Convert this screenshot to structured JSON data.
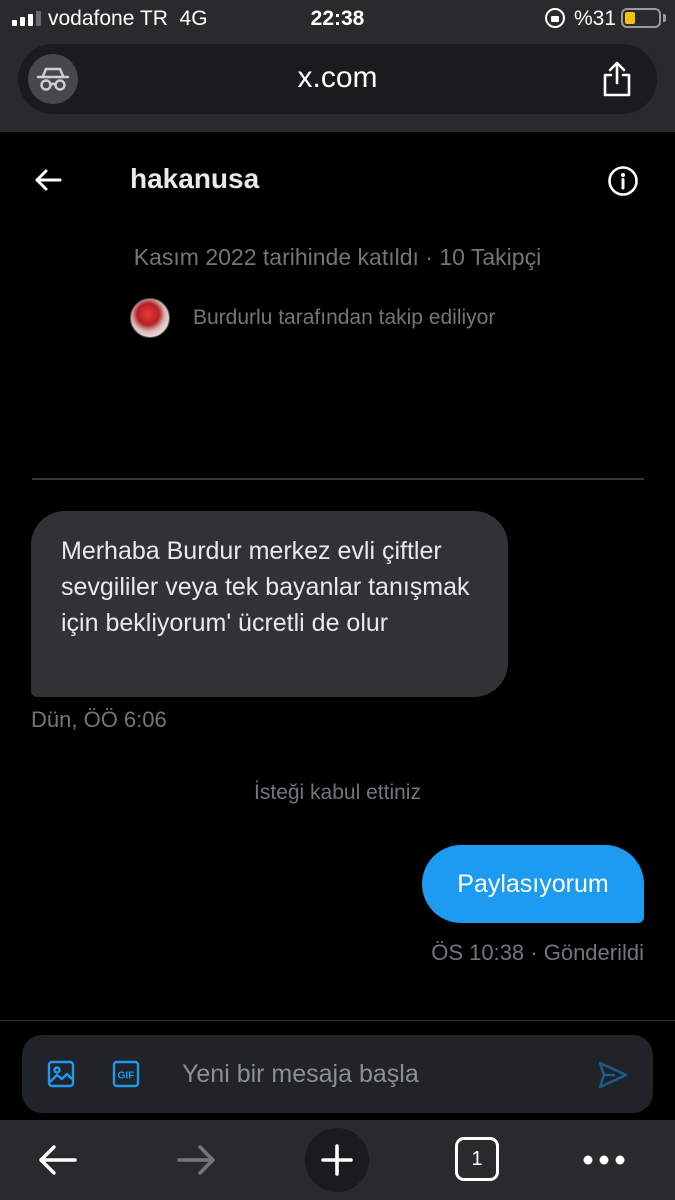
{
  "status_bar": {
    "carrier": "vodafone TR  4G",
    "time": "22:38",
    "battery": "%31",
    "battery_level": 0.31
  },
  "browser": {
    "url": "x.com",
    "icons": {
      "incognito": "incognito-icon",
      "share": "share-icon"
    }
  },
  "chat": {
    "title": "hakanusa",
    "profile_meta": "Kasım 2022 tarihinde katıldı · 10 Takipçi",
    "followed_by": "Burdurlu tarafından takip ediliyor",
    "icons": {
      "back": "arrow-left-icon",
      "info": "info-icon"
    }
  },
  "messages": [
    {
      "direction": "incoming",
      "text": "Merhaba Burdur merkez evli çiftler sevgililer veya tek bayanlar tanışmak için bekliyorum' ücretli de olur",
      "time": "Dün, ÖÖ 6:06"
    },
    {
      "direction": "outgoing",
      "text": "Paylasıyorum",
      "time": "ÖS 10:38 · Gönderildi"
    }
  ],
  "request_note": "İsteği kabul ettiniz",
  "composer": {
    "placeholder": "Yeni bir mesaja başla",
    "accent": "#1d9bf0",
    "icons": {
      "media": "image-icon",
      "gif": "gif-icon",
      "send": "send-icon"
    }
  },
  "toolbar": {
    "tab_count": "1",
    "icons": {
      "back": "arrow-left-icon",
      "forward": "arrow-right-icon",
      "new_tab": "plus-icon",
      "tabs": "tabs-icon",
      "more": "more-icon"
    }
  },
  "colors": {
    "background": "#000000",
    "bubble_incoming": "#2f3336",
    "bubble_outgoing": "#1d9bf0",
    "muted_text": "#71767b"
  }
}
